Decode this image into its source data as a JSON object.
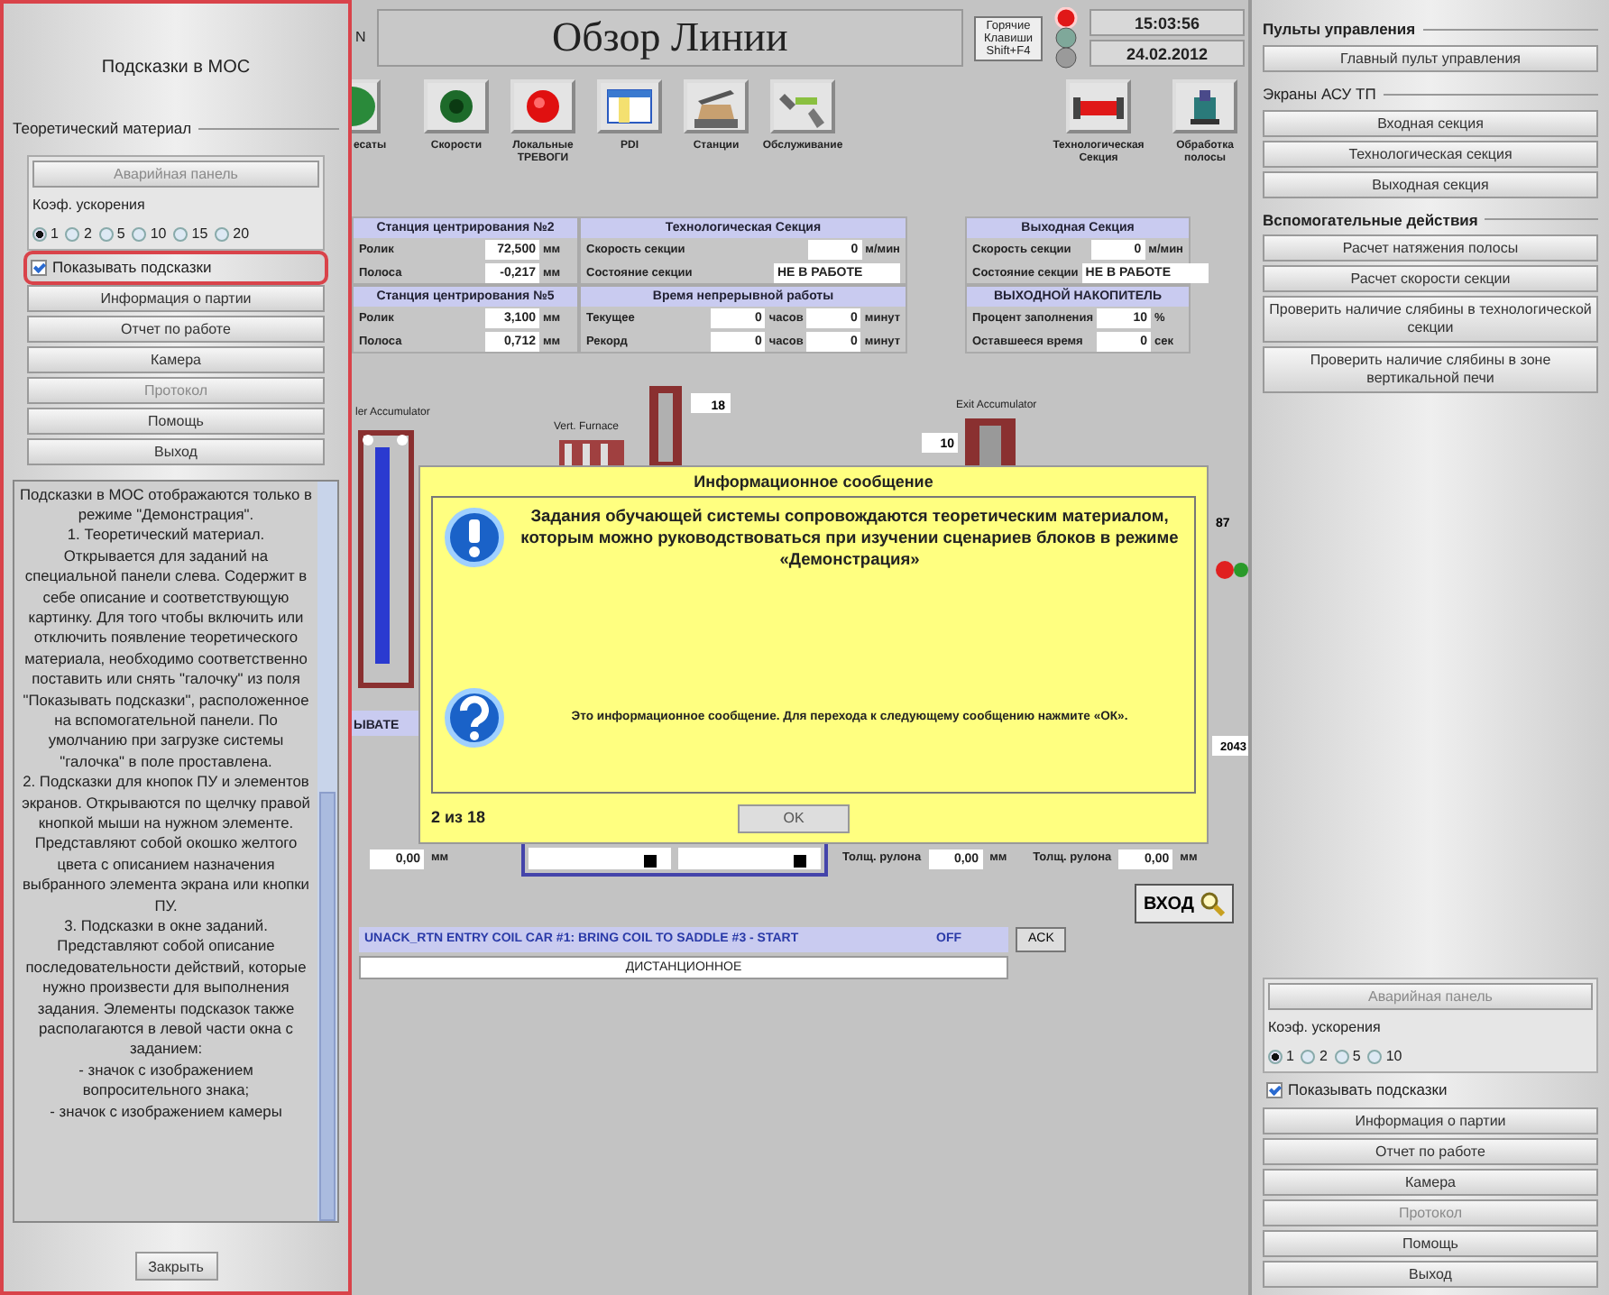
{
  "hints_panel": {
    "title": "Подсказки в МОС",
    "group": "Теоретический материал",
    "controls": {
      "top_button": {
        "label": "Аварийная панель",
        "disabled": true
      },
      "speed_label": "Коэф. ускорения",
      "speeds": [
        {
          "label": "1",
          "selected": true
        },
        {
          "label": "2",
          "selected": false
        },
        {
          "label": "5",
          "selected": false
        },
        {
          "label": "10",
          "selected": false
        },
        {
          "label": "15",
          "selected": false
        },
        {
          "label": "20",
          "selected": false
        }
      ],
      "show_hints": {
        "label": "Показывать подсказки",
        "checked": true,
        "highlighted": true
      },
      "buttons": [
        {
          "label": "Информация о партии",
          "disabled": false
        },
        {
          "label": "Отчет по работе",
          "disabled": false
        },
        {
          "label": "Камера",
          "disabled": false
        },
        {
          "label": "Протокол",
          "disabled": true
        },
        {
          "label": "Помощь",
          "disabled": false
        },
        {
          "label": "Выход",
          "disabled": false
        }
      ]
    },
    "help_text": [
      "Подсказки в МОС отображаются только в режиме \"Демонстрация\".",
      "1. Теоретический материал. Открывается для заданий на специальной панели слева. Содержит в себе описание и соответствующую картинку. Для того чтобы включить или отключить появление теоретического материала, необходимо соответственно поставить или снять \"галочку\" из поля \"Показывать подсказки\", расположенное на вспомогательной панели. По умолчанию при загрузке системы \"галочка\" в поле проставлена.",
      "2. Подсказки для кнопок ПУ и элементов экранов. Открываются по щелчку правой кнопкой мыши на нужном элементе. Представляют собой окошко желтого цвета с описанием назначения выбранного элемента экрана или кнопки ПУ.",
      "3. Подсказки в окне заданий. Представляют собой описание последовательности действий, которые нужно произвести для выполнения задания. Элементы подсказок также располагаются в левой части окна с заданием:",
      "- значок с изображением вопросительного знака;",
      "- значок с изображением камеры"
    ],
    "close": "Закрыть"
  },
  "line_overview": {
    "header_left": "N",
    "title": "Обзор Линии",
    "hotkeys": {
      "line1": "Горячие",
      "line2": "Клавиши",
      "shortcut": "Shift+F4"
    },
    "lamps": [
      {
        "color": "#e01818",
        "on": true
      },
      {
        "color": "#7fa89a",
        "on": false
      },
      {
        "color": "#9a9a9a",
        "on": false
      }
    ],
    "time": "15:03:56",
    "date": "24.02.2012",
    "toolbar": [
      {
        "label": "есаты",
        "kind": "coil"
      },
      {
        "label": "Скорости",
        "kind": "green"
      },
      {
        "label": "Локальные ТРЕВОГИ",
        "kind": "red"
      },
      {
        "label": "PDI",
        "kind": "table"
      },
      {
        "label": "Станции",
        "kind": "press"
      },
      {
        "label": "Обслуживание",
        "kind": "tools"
      },
      {
        "label": "Технологическая Секция",
        "kind": "section"
      },
      {
        "label": "Обработка полосы",
        "kind": "machine"
      }
    ],
    "panels": [
      {
        "title": "Станция центрирования №2",
        "rows": [
          {
            "label": "Ролик",
            "fields": [
              {
                "value": "72,500",
                "unit": "мм"
              }
            ]
          },
          {
            "label": "Полоса",
            "fields": [
              {
                "value": "-0,217",
                "unit": "мм"
              }
            ]
          }
        ]
      },
      {
        "title": "Технологическая Секция",
        "rows": [
          {
            "label": "Скорость секции",
            "fields": [
              {
                "value": "0",
                "unit": "м/мин"
              }
            ]
          },
          {
            "label": "Состояние секции",
            "fields": [
              {
                "value": "НЕ В РАБОТЕ"
              }
            ]
          }
        ]
      },
      {
        "title": "Выходная Секция",
        "rows": [
          {
            "label": "Скорость секции",
            "fields": [
              {
                "value": "0",
                "unit": "м/мин"
              }
            ]
          },
          {
            "label": "Состояние секции",
            "fields": [
              {
                "value": "НЕ В РАБОТЕ"
              }
            ]
          }
        ]
      },
      {
        "title": "Станция центрирования №5",
        "rows": [
          {
            "label": "Ролик",
            "fields": [
              {
                "value": "3,100",
                "unit": "мм"
              }
            ]
          },
          {
            "label": "Полоса",
            "fields": [
              {
                "value": "0,712",
                "unit": "мм"
              }
            ]
          }
        ]
      },
      {
        "title": "Время непрерывной работы",
        "rows": [
          {
            "label": "Текущее",
            "fields": [
              {
                "value": "0",
                "unit": "часов"
              },
              {
                "value": "0",
                "unit": "минут"
              }
            ]
          },
          {
            "label": "Рекорд",
            "fields": [
              {
                "value": "0",
                "unit": "часов"
              },
              {
                "value": "0",
                "unit": "минут"
              }
            ]
          }
        ]
      },
      {
        "title": "ВЫХОДНОЙ НАКОПИТЕЛЬ",
        "rows": [
          {
            "label": "Процент заполнения",
            "fields": [
              {
                "value": "10",
                "unit": "%"
              }
            ]
          },
          {
            "label": "Оставшееся время",
            "fields": [
              {
                "value": "0",
                "unit": "сек"
              }
            ]
          }
        ]
      }
    ],
    "diagram": {
      "entry_label": "ler Accumulator",
      "furnace_label": "Vert. Furnace",
      "tower_value": "18",
      "exit_label": "Exit Accumulator",
      "exit_value": "10",
      "right_value": "87",
      "left_band": "ЫВАТЕ",
      "right_value_2": "2043"
    },
    "lower_row": {
      "left_field": {
        "value": "0,00",
        "unit": "мм"
      },
      "thickness": [
        {
          "label": "Толщ. рулона",
          "value": "0,00",
          "unit": "мм"
        },
        {
          "label": "Толщ. рулона",
          "value": "0,00",
          "unit": "мм"
        }
      ]
    },
    "enter_button": "ВХОД",
    "alarm": {
      "message": "UNACK_RTN ENTRY COIL CAR #1: BRING COIL TO SADDLE #3 - START",
      "state": "OFF",
      "ack": "ACK"
    },
    "mode": "ДИСТАНЦИОННОЕ"
  },
  "dialog": {
    "title": "Информационное сообщение",
    "messages": [
      {
        "kind": "warning",
        "text": "Задания обучающей системы сопровождаются теоретическим материалом, которым можно руководствоваться при изучении сценариев блоков в режиме «Демонстрация»"
      },
      {
        "kind": "question",
        "text": "Это информационное сообщение. Для перехода к следующему сообщению нажмите «ОК»."
      }
    ],
    "counter": "2 из 18",
    "ok": "OK"
  },
  "control_panel": {
    "groups": [
      {
        "title": "Пульты управления",
        "kind": "bold",
        "buttons": [
          "Главный пульт управления"
        ]
      },
      {
        "title": "Экраны АСУ ТП",
        "kind": "plain",
        "buttons": [
          "Входная секция",
          "Технологическая секция",
          "Выходная секция"
        ]
      },
      {
        "title": "Вспомогательные действия",
        "kind": "bold",
        "buttons": [
          "Расчет натяжения полосы",
          "Расчет скорости секции",
          "Проверить наличие слябины в технологической секции",
          "Проверить наличие слябины в зоне вертикальной печи"
        ]
      }
    ],
    "controls": {
      "top_button": {
        "label": "Аварийная панель",
        "disabled": true
      },
      "speed_label": "Коэф. ускорения",
      "speeds": [
        {
          "label": "1",
          "selected": true
        },
        {
          "label": "2",
          "selected": false
        },
        {
          "label": "5",
          "selected": false
        },
        {
          "label": "10",
          "selected": false
        }
      ],
      "show_hints": {
        "label": "Показывать подсказки",
        "checked": true,
        "highlighted": false
      },
      "buttons": [
        {
          "label": "Информация о партии",
          "disabled": false
        },
        {
          "label": "Отчет по работе",
          "disabled": false
        },
        {
          "label": "Камера",
          "disabled": false
        },
        {
          "label": "Протокол",
          "disabled": true
        },
        {
          "label": "Помощь",
          "disabled": false
        },
        {
          "label": "Выход",
          "disabled": false
        }
      ]
    }
  }
}
